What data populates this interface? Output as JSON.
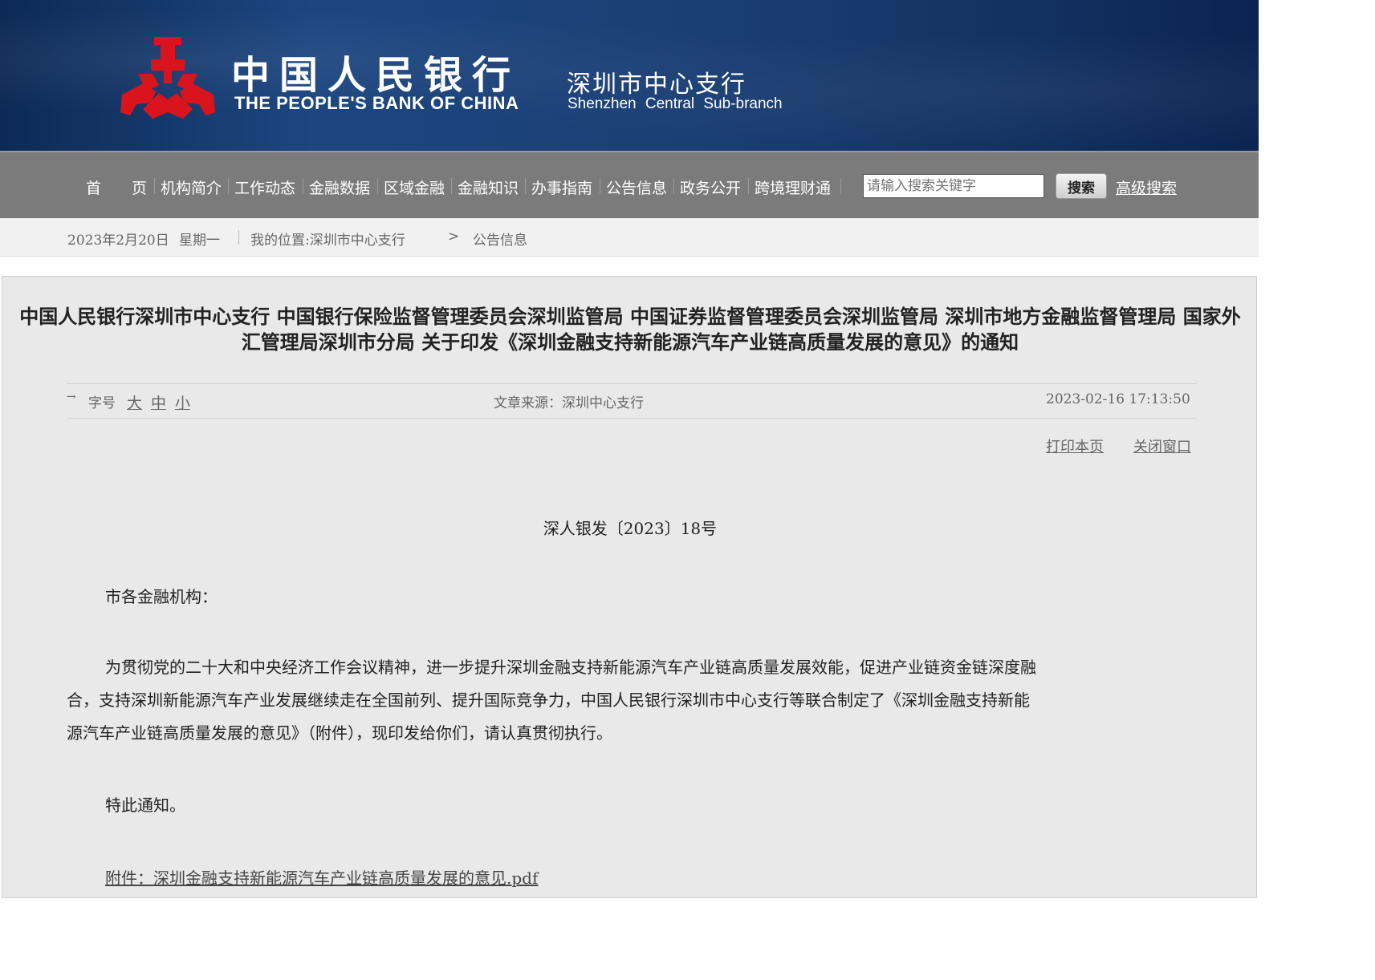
{
  "header": {
    "bank_name_cn": "中国人民银行",
    "bank_name_en": "THE PEOPLE'S BANK OF CHINA",
    "branch_name_cn": "深圳市中心支行",
    "branch_name_en": "Shenzhen Central Sub-branch",
    "emblem_color": "#d9141c",
    "banner_color": "#1d4680"
  },
  "nav": {
    "items": [
      {
        "label": "首　　页"
      },
      {
        "label": "机构简介"
      },
      {
        "label": "工作动态"
      },
      {
        "label": "金融数据"
      },
      {
        "label": "区域金融"
      },
      {
        "label": "金融知识"
      },
      {
        "label": "办事指南"
      },
      {
        "label": "公告信息"
      },
      {
        "label": "政务公开"
      },
      {
        "label": "跨境理财通"
      }
    ],
    "search_placeholder": "请输入搜索关键字",
    "search_button": "搜索",
    "advanced_search": "高级搜索"
  },
  "breadcrumb": {
    "date": "2023年2月20日",
    "weekday": "星期一",
    "location_label": "我的位置:深圳市中心支行",
    "arrow": ">",
    "current": "公告信息"
  },
  "article": {
    "title": "中国人民银行深圳市中心支行 中国银行保险监督管理委员会深圳监管局 中国证券监督管理委员会深圳监管局 深圳市地方金融监督管理局 国家外汇管理局深圳市分局 关于印发《深圳金融支持新能源汽车产业链高质量发展的意见》的通知",
    "font_size_label": "字号",
    "font_large": "大",
    "font_medium": "中",
    "font_small": "小",
    "source": "文章来源：深圳中心支行",
    "datetime": "2023-02-16 17:13:50",
    "print": "打印本页",
    "close": "关闭窗口",
    "doc_number": "深人银发〔2023〕18号",
    "salutation": "市各金融机构：",
    "body_line1": "为贯彻党的二十大和中央经济工作会议精神，进一步提升深圳金融支持新能源汽车产业链高质量发展效能，促进产业链资金链深度融",
    "body_line2": "合，支持深圳新能源汽车产业发展继续走在全国前列、提升国际竞争力，中国人民银行深圳市中心支行等联合制定了《深圳金融支持新能",
    "body_line3": "源汽车产业链高质量发展的意见》（附件），现印发给你们，请认真贯彻执行。",
    "closing": "特此通知。",
    "attachment": "附件：深圳金融支持新能源汽车产业链高质量发展的意见.pdf"
  }
}
